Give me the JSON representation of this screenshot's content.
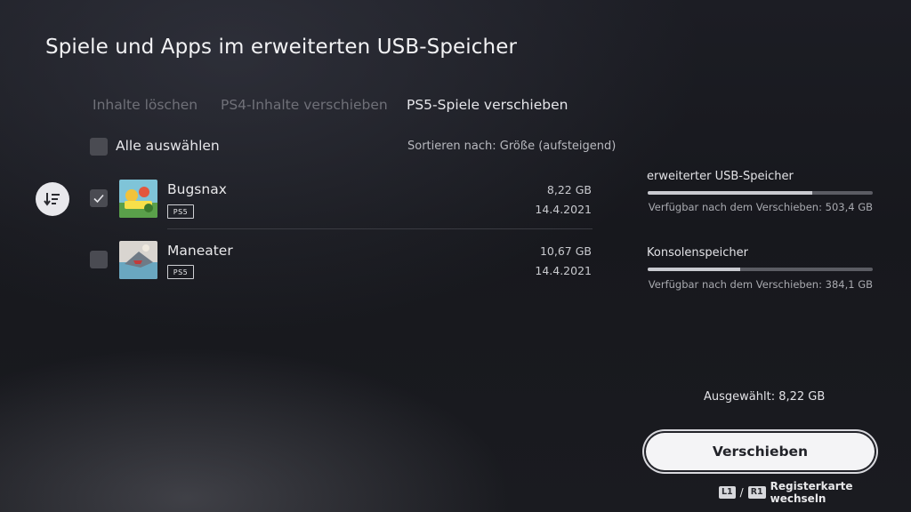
{
  "page": {
    "title": "Spiele und Apps im erweiterten USB-Speicher"
  },
  "tabs": [
    {
      "label": "Inhalte löschen",
      "active": false
    },
    {
      "label": "PS4-Inhalte verschieben",
      "active": false
    },
    {
      "label": "PS5-Spiele verschieben",
      "active": true
    }
  ],
  "list": {
    "select_all_label": "Alle auswählen",
    "select_all_checked": false,
    "sort_label": "Sortieren nach: Größe (aufsteigend)",
    "sort_icon": "sort-descending-icon",
    "games": [
      {
        "name": "Bugsnax",
        "badge": "PS5",
        "size": "8,22 GB",
        "date": "14.4.2021",
        "checked": true
      },
      {
        "name": "Maneater",
        "badge": "PS5",
        "size": "10,67 GB",
        "date": "14.4.2021",
        "checked": false
      }
    ]
  },
  "storage": {
    "usb": {
      "title": "erweiterter USB-Speicher",
      "available": "Verfügbar nach dem Verschieben: 503,4 GB",
      "used_fraction": 0.73
    },
    "console": {
      "title": "Konsolenspeicher",
      "available": "Verfügbar nach dem Verschieben: 384,1 GB",
      "used_fraction": 0.41
    }
  },
  "selection": {
    "summary": "Ausgewählt: 8,22 GB"
  },
  "actions": {
    "move_label": "Verschieben"
  },
  "hint": {
    "key_left": "L1",
    "separator": "/",
    "key_right": "R1",
    "text": "Registerkarte wechseln"
  },
  "colors": {
    "accent": "#f4f4f6",
    "background": "#1a1b20",
    "checkbox": "#4a4b52"
  }
}
